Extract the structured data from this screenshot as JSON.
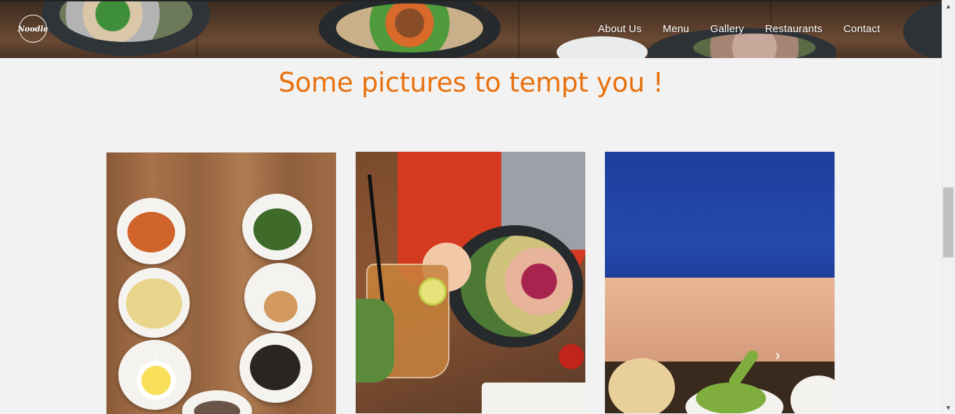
{
  "brand": {
    "logo_text": "Noodle"
  },
  "nav": {
    "items": [
      {
        "label": "About Us"
      },
      {
        "label": "Menu"
      },
      {
        "label": "Gallery"
      },
      {
        "label": "Restaurants"
      },
      {
        "label": "Contact"
      }
    ]
  },
  "gallery": {
    "title": "Some pictures to tempt you !",
    "prev_icon": "chevron-left-icon",
    "next_icon": "chevron-right-icon"
  },
  "colors": {
    "accent": "#e8710f",
    "page_bg": "#f2f2f2"
  }
}
